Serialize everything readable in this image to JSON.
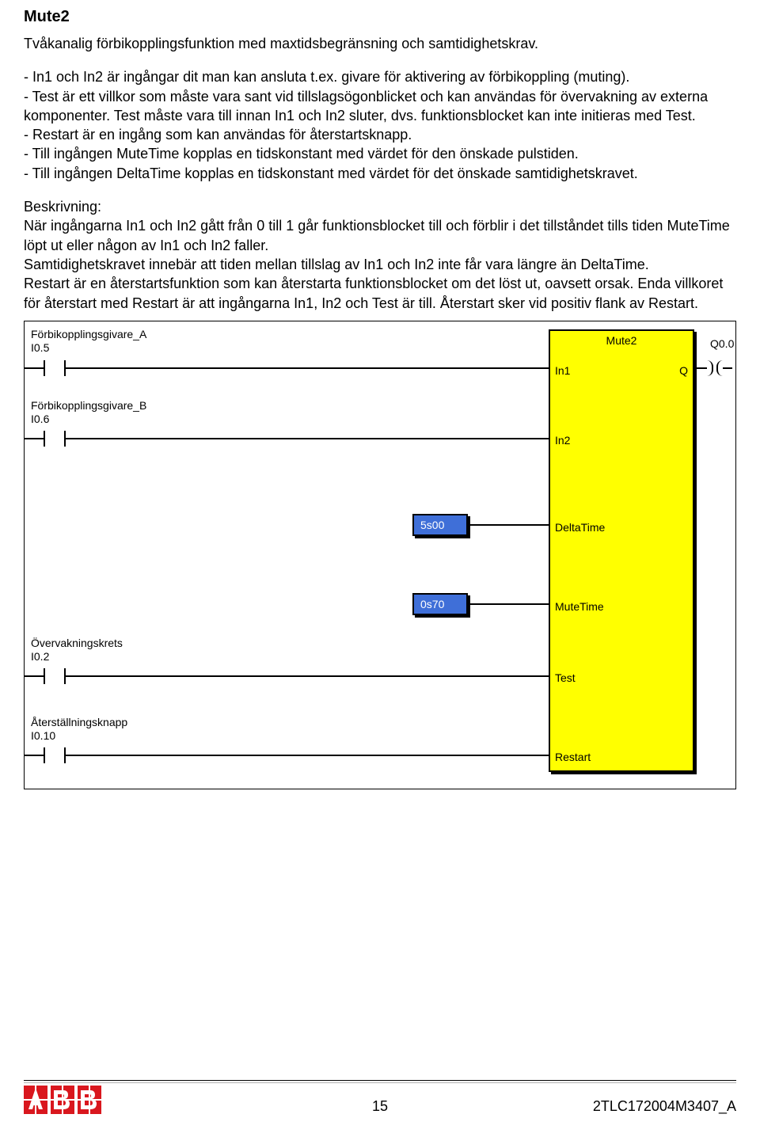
{
  "title": "Mute2",
  "intro": "Tvåkanalig förbikopplingsfunktion med maxtidsbegränsning och samtidighetskrav.",
  "bullets": [
    "- In1 och In2 är ingångar dit man kan ansluta t.ex. givare för aktivering av förbikoppling (muting).",
    "- Test är ett villkor som måste vara sant vid tillslagsögonblicket och kan användas för övervakning av externa komponenter. Test måste vara till innan In1 och In2 sluter, dvs. funktionsblocket kan inte initieras med Test.",
    "- Restart är en ingång som kan användas för återstartsknapp.",
    "- Till ingången MuteTime kopplas en tidskonstant med värdet för den önskade pulstiden.",
    "- Till ingången DeltaTime kopplas en tidskonstant med värdet för det önskade samtidighetskravet."
  ],
  "desc_label": "Beskrivning:",
  "desc_lines": [
    "När ingångarna In1 och In2 gått från 0 till 1 går funktionsblocket till och förblir i det tillståndet tills tiden MuteTime löpt ut eller någon av In1 och In2 faller.",
    "Samtidighetskravet innebär att tiden mellan tillslag av In1 och In2 inte får vara längre än DeltaTime.",
    "Restart är en återstartsfunktion som kan återstarta funktionsblocket om det löst ut, oavsett orsak. Enda villkoret för återstart med Restart är att ingångarna In1, In2 och Test är till. Återstart sker vid positiv flank av Restart."
  ],
  "diagram": {
    "block_title": "Mute2",
    "inputs": [
      {
        "name": "Förbikopplingsgivare_A",
        "addr": "I0.5",
        "pin": "In1"
      },
      {
        "name": "Förbikopplingsgivare_B",
        "addr": "I0.6",
        "pin": "In2"
      },
      {
        "name": "Övervakningskrets",
        "addr": "I0.2",
        "pin": "Test"
      },
      {
        "name": "Återställningsknapp",
        "addr": "I0.10",
        "pin": "Restart"
      }
    ],
    "constants": [
      {
        "value": "5s00",
        "pin": "DeltaTime"
      },
      {
        "value": "0s70",
        "pin": "MuteTime"
      }
    ],
    "output": {
      "pin": "Q",
      "addr": "Q0.0"
    }
  },
  "footer": {
    "page": "15",
    "doc_id": "2TLC172004M3407_A"
  }
}
